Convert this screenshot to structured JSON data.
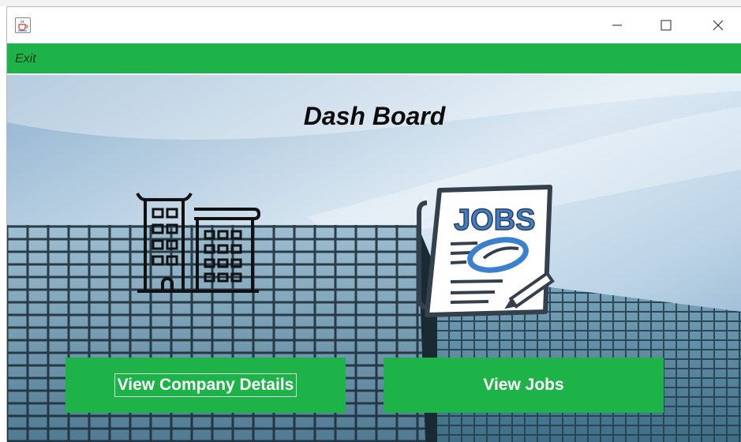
{
  "window": {
    "icon": "java-cup-icon",
    "controls": {
      "minimize": "minimize-icon",
      "maximize": "maximize-icon",
      "close": "close-icon"
    }
  },
  "menubar": {
    "exit_label": "Exit",
    "color": "#1db348"
  },
  "dashboard": {
    "title": "Dash Board",
    "company_icon": "office-buildings-icon",
    "jobs_icon": "jobs-newspaper-icon",
    "jobs_icon_text": "JOBS",
    "view_company_label": "View Company Details",
    "view_jobs_label": "View Jobs",
    "button_color": "#1db348"
  }
}
